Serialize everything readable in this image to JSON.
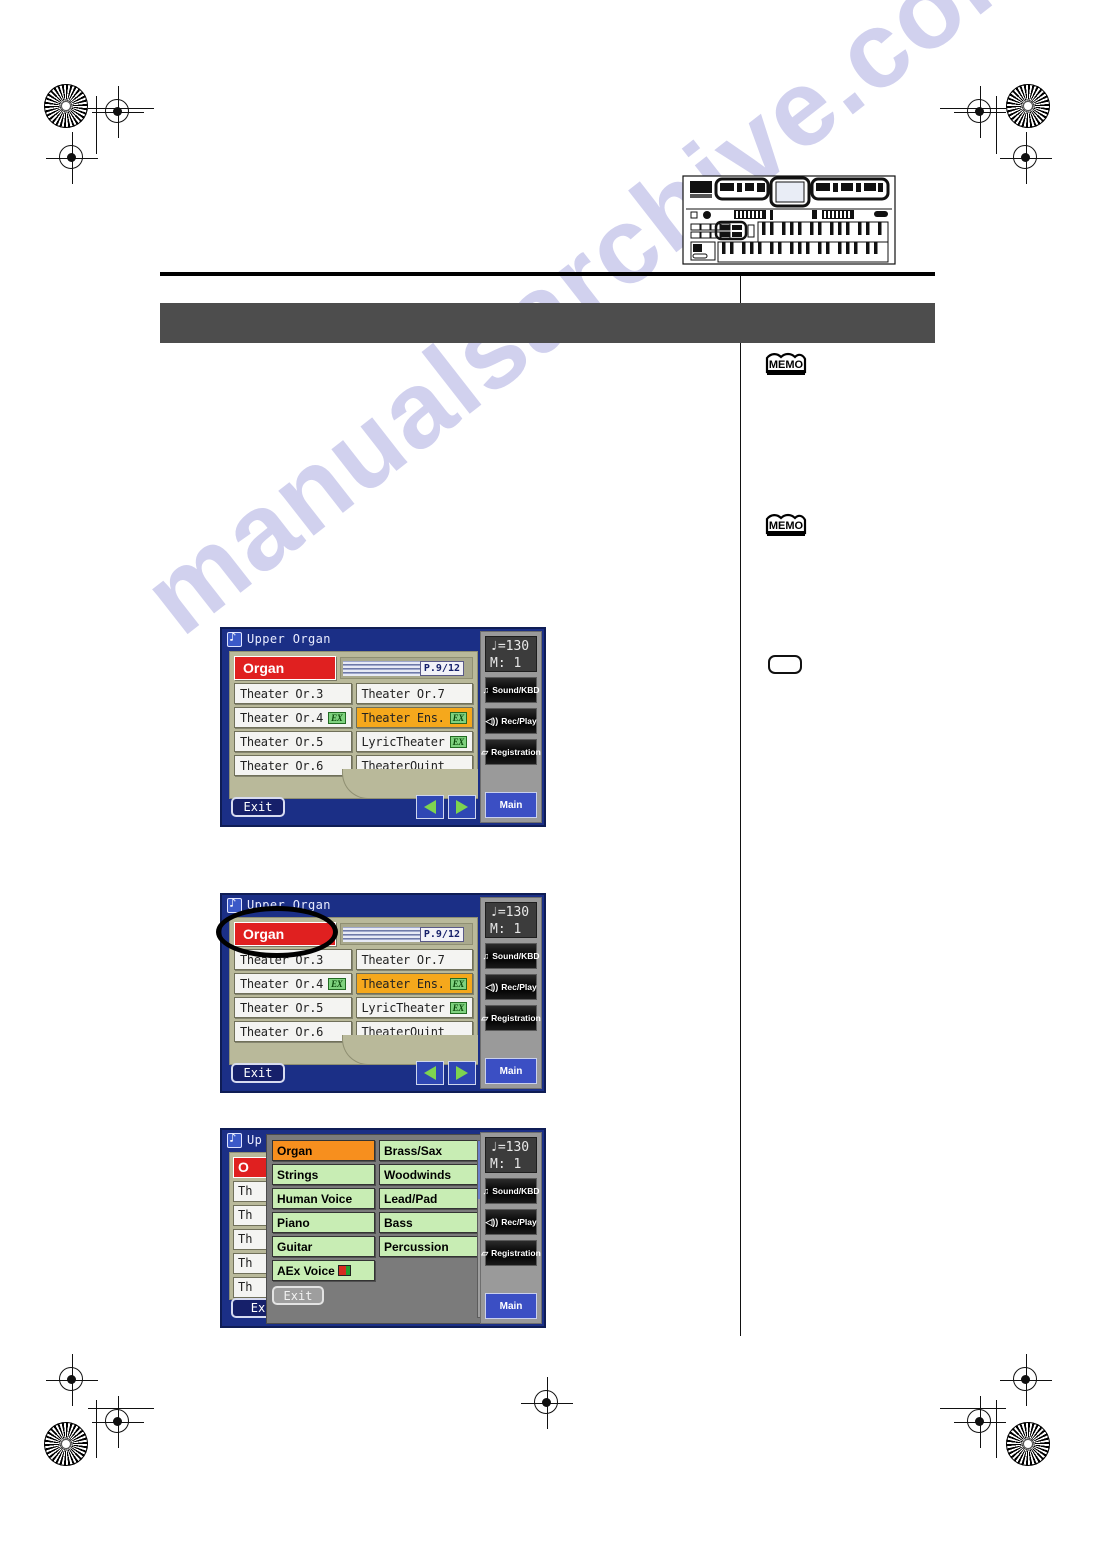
{
  "page": {
    "watermark": "manualsarchive.com",
    "header_band_text": "",
    "illustration_name": "organ-keyboard-diagram"
  },
  "margin_notes": [
    {
      "icon": "memo-icon",
      "label": "MEMO"
    },
    {
      "icon": "memo-icon",
      "label": "MEMO"
    }
  ],
  "screens": [
    {
      "id": "screen-voice-list",
      "title": "Upper Organ",
      "category_button": "Organ",
      "page_indicator": "P.9/12",
      "voices": [
        {
          "label": "Theater Or.3",
          "badge": "",
          "selected": false
        },
        {
          "label": "Theater Or.7",
          "badge": "",
          "selected": false
        },
        {
          "label": "Theater Or.4",
          "badge": "EX",
          "selected": false
        },
        {
          "label": "Theater Ens.",
          "badge": "EX",
          "selected": true
        },
        {
          "label": "Theater Or.5",
          "badge": "",
          "selected": false
        },
        {
          "label": "LyricTheater",
          "badge": "EX",
          "selected": false
        },
        {
          "label": "Theater Or.6",
          "badge": "",
          "selected": false
        },
        {
          "label": "TheaterQuint",
          "badge": "",
          "selected": false
        }
      ],
      "exit_label": "Exit",
      "prev_icon": "triangle-left-icon",
      "next_icon": "triangle-right-icon",
      "rail": {
        "tempo_line1": "♩=130",
        "tempo_line2": "M:    1",
        "buttons": [
          {
            "label": "Sound/KBD",
            "icon": "music-note-icon"
          },
          {
            "label": "Rec/Play",
            "icon": "speaker-icon"
          },
          {
            "label": "Registration",
            "icon": "registration-icon"
          }
        ],
        "main_label": "Main"
      }
    },
    {
      "id": "screen-voice-list-annotated",
      "title": "Upper Organ",
      "category_button": "Organ",
      "page_indicator": "P.9/12",
      "annotation": "ellipse-highlight-organ-button",
      "voices": [
        {
          "label": "Theater Or.3",
          "badge": "",
          "selected": false
        },
        {
          "label": "Theater Or.7",
          "badge": "",
          "selected": false
        },
        {
          "label": "Theater Or.4",
          "badge": "EX",
          "selected": false
        },
        {
          "label": "Theater Ens.",
          "badge": "EX",
          "selected": true
        },
        {
          "label": "Theater Or.5",
          "badge": "",
          "selected": false
        },
        {
          "label": "LyricTheater",
          "badge": "EX",
          "selected": false
        },
        {
          "label": "Theater Or.6",
          "badge": "",
          "selected": false
        },
        {
          "label": "TheaterQuint",
          "badge": "",
          "selected": false
        }
      ],
      "exit_label": "Exit",
      "prev_icon": "triangle-left-icon",
      "next_icon": "triangle-right-icon",
      "rail": {
        "tempo_line1": "♩=130",
        "tempo_line2": "M:    1",
        "buttons": [
          {
            "label": "Sound/KBD",
            "icon": "music-note-icon"
          },
          {
            "label": "Rec/Play",
            "icon": "speaker-icon"
          },
          {
            "label": "Registration",
            "icon": "registration-icon"
          }
        ],
        "main_label": "Main"
      }
    },
    {
      "id": "screen-category-popup",
      "title": "Up",
      "under_stubs": [
        "O",
        "Th",
        "Th",
        "Th",
        "Th",
        "Th"
      ],
      "under_exit": "Ex",
      "categories": [
        {
          "label": "Organ",
          "active": true
        },
        {
          "label": "Brass/Sax",
          "active": false
        },
        {
          "label": "Strings",
          "active": false
        },
        {
          "label": "Woodwinds",
          "active": false
        },
        {
          "label": "Human Voice",
          "active": false
        },
        {
          "label": "Lead/Pad",
          "active": false
        },
        {
          "label": "Piano",
          "active": false
        },
        {
          "label": "Bass",
          "active": false
        },
        {
          "label": "Guitar",
          "active": false
        },
        {
          "label": "Percussion",
          "active": false
        }
      ],
      "aex_label": "AEx Voice",
      "aex_icon": "aex-indicator-icon",
      "popup_exit_label": "Exit",
      "rail": {
        "tempo_line1": "♩=130",
        "tempo_line2": "M:    1",
        "buttons": [
          {
            "label": "Sound/KBD",
            "icon": "music-note-icon"
          },
          {
            "label": "Rec/Play",
            "icon": "speaker-icon"
          },
          {
            "label": "Registration",
            "icon": "registration-icon"
          }
        ],
        "main_label": "Main"
      }
    }
  ],
  "colors": {
    "lcd_background": "#1b2f86",
    "panel": "#b9b99a",
    "selected_voice": "#f5a81c",
    "category_red": "#e02020",
    "category_green": "#c8edb4",
    "category_active_orange": "#f78f1e",
    "header_band": "#4d4d4d",
    "main_button": "#3b4fc4"
  }
}
